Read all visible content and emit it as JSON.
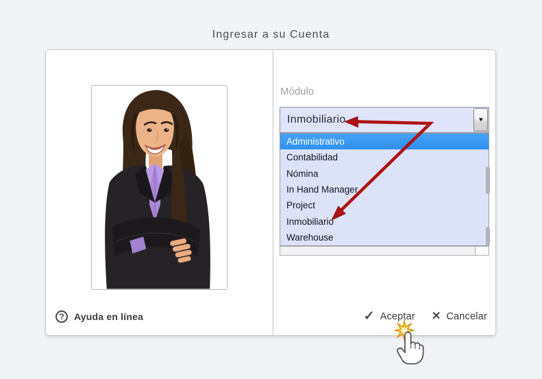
{
  "page": {
    "title": "Ingresar a su Cuenta"
  },
  "module": {
    "label": "Módulo",
    "selected": "Inmobiliario",
    "highlighted_option": "Administrativo",
    "options": [
      "Administrativo",
      "Contabilidad",
      "Nómina",
      "In Hand Manager",
      "Project",
      "Inmobiliario",
      "Warehouse"
    ]
  },
  "footer": {
    "help_label": "Ayuda en línea",
    "accept_label": "Aceptar",
    "cancel_label": "Cancelar"
  },
  "icons": {
    "question_mark": "?",
    "check": "✓",
    "cross": "✕",
    "dropdown_arrow": "▼"
  },
  "portrait": {
    "description": "Smiling woman with long dark hair, lavender blouse and black blazer, arms crossed"
  },
  "colors": {
    "highlight_blue": "#3399f0",
    "field_lavender": "#dce3f9",
    "annotation_arrow_red": "#ad1313",
    "starburst_gold": "#f2ae00"
  }
}
